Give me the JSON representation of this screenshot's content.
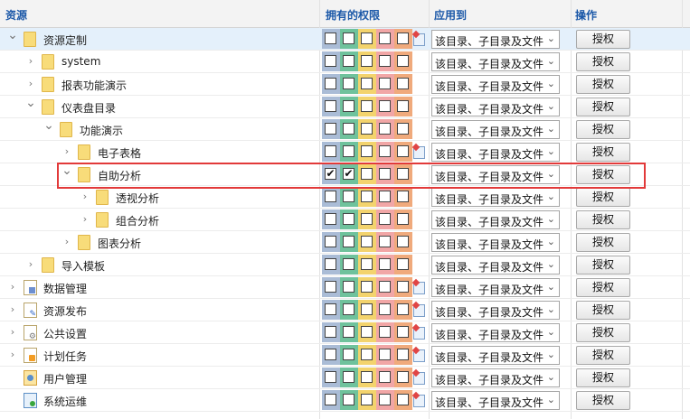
{
  "header": {
    "resource": "资源",
    "permissions": "拥有的权限",
    "apply_to": "应用到",
    "actions": "操作"
  },
  "apply_option": "该目录、子目录及文件",
  "grant_label": "授权",
  "permission_colors": [
    "#aabcd6",
    "#6fc29c",
    "#f3d36d",
    "#f1a6a6",
    "#f0aa7c"
  ],
  "rows": [
    {
      "label": "资源定制",
      "expand": "open",
      "icon": "folder-icon",
      "inherit_icon": true,
      "checked": [
        false,
        false,
        false,
        false,
        false
      ],
      "selected": true
    },
    {
      "label": "system",
      "expand": "closed",
      "icon": "folder-icon",
      "inherit_icon": false,
      "checked": [
        false,
        false,
        false,
        false,
        false
      ]
    },
    {
      "label": "报表功能演示",
      "expand": "closed",
      "icon": "folder-icon",
      "inherit_icon": false,
      "checked": [
        false,
        false,
        false,
        false,
        false
      ]
    },
    {
      "label": "仪表盘目录",
      "expand": "open",
      "icon": "folder-icon",
      "inherit_icon": false,
      "checked": [
        false,
        false,
        false,
        false,
        false
      ]
    },
    {
      "label": "功能演示",
      "expand": "open",
      "icon": "folder-icon",
      "inherit_icon": false,
      "checked": [
        false,
        false,
        false,
        false,
        false
      ]
    },
    {
      "label": "电子表格",
      "expand": "closed",
      "icon": "folder-icon",
      "inherit_icon": true,
      "checked": [
        false,
        false,
        false,
        false,
        false
      ]
    },
    {
      "label": "自助分析",
      "expand": "open",
      "icon": "folder-icon",
      "inherit_icon": false,
      "checked": [
        true,
        true,
        false,
        false,
        false
      ],
      "highlighted": true
    },
    {
      "label": "透视分析",
      "expand": "closed",
      "icon": "folder-icon",
      "inherit_icon": false,
      "checked": [
        false,
        false,
        false,
        false,
        false
      ]
    },
    {
      "label": "组合分析",
      "expand": "closed",
      "icon": "folder-icon",
      "inherit_icon": false,
      "checked": [
        false,
        false,
        false,
        false,
        false
      ]
    },
    {
      "label": "图表分析",
      "expand": "closed",
      "icon": "folder-icon",
      "inherit_icon": false,
      "checked": [
        false,
        false,
        false,
        false,
        false
      ]
    },
    {
      "label": "导入模板",
      "expand": "closed",
      "icon": "folder-icon",
      "inherit_icon": false,
      "checked": [
        false,
        false,
        false,
        false,
        false
      ]
    },
    {
      "label": "数据管理",
      "expand": "closed",
      "icon": "data-management-icon",
      "inherit_icon": true,
      "checked": [
        false,
        false,
        false,
        false,
        false
      ]
    },
    {
      "label": "资源发布",
      "expand": "closed",
      "icon": "resource-publish-icon",
      "inherit_icon": true,
      "checked": [
        false,
        false,
        false,
        false,
        false
      ]
    },
    {
      "label": "公共设置",
      "expand": "closed",
      "icon": "public-settings-icon",
      "inherit_icon": true,
      "checked": [
        false,
        false,
        false,
        false,
        false
      ]
    },
    {
      "label": "计划任务",
      "expand": "closed",
      "icon": "scheduled-task-icon",
      "inherit_icon": true,
      "checked": [
        false,
        false,
        false,
        false,
        false
      ]
    },
    {
      "label": "用户管理",
      "expand": "none",
      "icon": "user-management-icon",
      "inherit_icon": true,
      "checked": [
        false,
        false,
        false,
        false,
        false
      ]
    },
    {
      "label": "系统运维",
      "expand": "none",
      "icon": "system-ops-icon",
      "inherit_icon": true,
      "checked": [
        false,
        false,
        false,
        false,
        false
      ]
    }
  ]
}
